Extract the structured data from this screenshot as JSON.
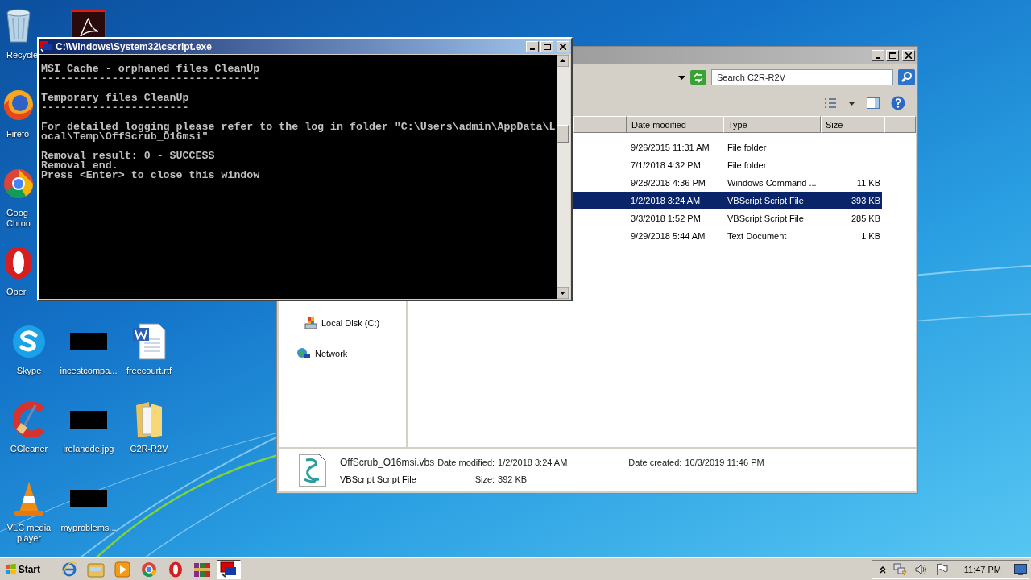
{
  "desktop_icons": [
    {
      "kind": "recycle-bin",
      "label": "Recycle"
    },
    {
      "kind": "firefox",
      "label": "Firefo"
    },
    {
      "kind": "chrome",
      "label": "Goog Chron"
    },
    {
      "kind": "opera",
      "label": "Oper"
    },
    {
      "kind": "skype",
      "label": "Skype"
    },
    {
      "kind": "ccleaner",
      "label": "CCleaner"
    },
    {
      "kind": "vlc",
      "label": "VLC media player"
    },
    {
      "kind": "acrobat"
    },
    {
      "kind": "redacted",
      "label": "incestcompa..."
    },
    {
      "kind": "redacted",
      "label": "irelandde.jpg"
    },
    {
      "kind": "redacted",
      "label": "myproblems..."
    },
    {
      "kind": "word",
      "label": "freecourt.rtf"
    },
    {
      "kind": "folder",
      "label": "C2R-R2V"
    }
  ],
  "explorer": {
    "search": {
      "placeholder": "Search C2R-R2V"
    },
    "columns": [
      "Date modified",
      "Type",
      "Size"
    ],
    "rows": [
      {
        "date": "9/26/2015 11:31 AM",
        "type": "File folder",
        "selected": false
      },
      {
        "date": "7/1/2018 4:32 PM",
        "type": "File folder",
        "selected": false
      },
      {
        "date": "9/28/2018 4:36 PM",
        "type": "Windows Command ...",
        "size": "11 KB",
        "selected": false
      },
      {
        "date": "1/2/2018 3:24 AM",
        "type": "VBScript Script File",
        "size": "393 KB",
        "selected": true
      },
      {
        "date": "3/3/2018 1:52 PM",
        "type": "VBScript Script File",
        "size": "285 KB",
        "selected": false
      },
      {
        "date": "9/29/2018 5:44 AM",
        "type": "Text Document",
        "size": "1 KB",
        "selected": false
      }
    ],
    "nav_items": [
      {
        "kind": "drive",
        "label": "Local Disk (C:)"
      },
      {
        "kind": "network",
        "label": "Network"
      }
    ],
    "details": {
      "name": "OffScrub_O16msi.vbs",
      "type": "VBScript Script File",
      "modified_label": "Date modified:",
      "modified": "1/2/2018 3:24 AM",
      "size_label": "Size:",
      "size": "392 KB",
      "created_label": "Date created:",
      "created": "10/3/2019 11:46 PM"
    }
  },
  "console": {
    "title": "C:\\Windows\\System32\\cscript.exe",
    "blocks": [
      [
        "MSI Cache - orphaned files CleanUp",
        "----------------------------------"
      ],
      [
        "Temporary files CleanUp",
        "-----------------------"
      ],
      [
        "For detailed logging please refer to the log in folder \"C:\\Users\\admin\\AppData\\L",
        "ocal\\Temp\\OffScrub_O16msi\""
      ],
      [
        "Removal result: 0 - SUCCESS",
        "Removal end.",
        "Press <Enter> to close this window"
      ]
    ]
  },
  "taskbar": {
    "start": "Start",
    "buttons": [
      {
        "kind": "ie",
        "active": false
      },
      {
        "kind": "explorer",
        "active": false
      },
      {
        "kind": "media",
        "active": false
      },
      {
        "kind": "chrome",
        "active": false
      },
      {
        "kind": "opera",
        "active": false
      },
      {
        "kind": "winrar",
        "active": false
      },
      {
        "kind": "cscript",
        "active": true
      }
    ],
    "tray": [
      {
        "kind": "chevron"
      },
      {
        "kind": "network"
      },
      {
        "kind": "volume"
      },
      {
        "kind": "flag"
      }
    ],
    "clock": "11:47 PM"
  }
}
